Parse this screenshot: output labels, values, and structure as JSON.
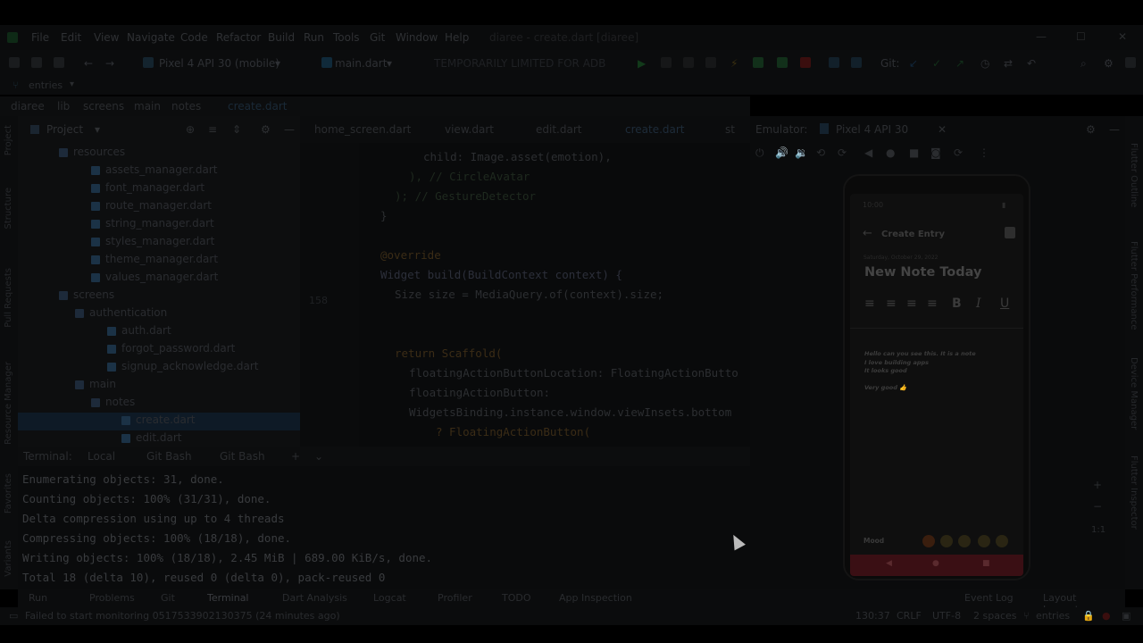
{
  "menu": {
    "items": [
      "File",
      "Edit",
      "View",
      "Navigate",
      "Code",
      "Refactor",
      "Build",
      "Run",
      "Tools",
      "Git",
      "Window",
      "Help"
    ],
    "app_title": "diaree - create.dart [diaree]"
  },
  "toolbar": {
    "device": "Pixel 4 API 30 (mobile)",
    "run_config": "main.dart",
    "status": "TEMPORARILY LIMITED FOR ADB",
    "git_label": "Git:",
    "branch": "entries"
  },
  "breadcrumb": [
    "diaree",
    "lib",
    "screens",
    "main",
    "notes",
    "create.dart"
  ],
  "project": {
    "title": "Project",
    "tree": [
      {
        "label": "resources",
        "type": "folder"
      },
      {
        "label": "assets_manager.dart",
        "type": "file"
      },
      {
        "label": "font_manager.dart",
        "type": "file"
      },
      {
        "label": "route_manager.dart",
        "type": "file"
      },
      {
        "label": "string_manager.dart",
        "type": "file"
      },
      {
        "label": "styles_manager.dart",
        "type": "file"
      },
      {
        "label": "theme_manager.dart",
        "type": "file"
      },
      {
        "label": "values_manager.dart",
        "type": "file"
      },
      {
        "label": "screens",
        "type": "folder"
      },
      {
        "label": "authentication",
        "type": "folder"
      },
      {
        "label": "auth.dart",
        "type": "file"
      },
      {
        "label": "forgot_password.dart",
        "type": "file"
      },
      {
        "label": "signup_acknowledge.dart",
        "type": "file"
      },
      {
        "label": "main",
        "type": "folder"
      },
      {
        "label": "notes",
        "type": "folder"
      },
      {
        "label": "create.dart",
        "type": "file"
      },
      {
        "label": "edit.dart",
        "type": "file"
      }
    ]
  },
  "editor": {
    "tabs": [
      "home_screen.dart",
      "view.dart",
      "edit.dart",
      "create.dart",
      "st"
    ],
    "line_number": "158",
    "code": [
      "child: Image.asset(emotion),",
      "), // CircleAvatar",
      "); // GestureDetector",
      "}",
      "",
      "@override",
      "Widget build(BuildContext context) {",
      "Size size = MediaQuery.of(context).size;",
      "",
      "",
      "return Scaffold(",
      "floatingActionButtonLocation: FloatingActionButto",
      "floatingActionButton:",
      "WidgetsBinding.instance.window.viewInsets.bottom",
      "? FloatingActionButton("
    ]
  },
  "terminal": {
    "tabs": [
      "Terminal:",
      "Local",
      "Git Bash",
      "Git Bash"
    ],
    "lines": [
      "Enumerating objects: 31, done.",
      "Counting objects: 100% (31/31), done.",
      "Delta compression using up to 4 threads",
      "Compressing objects: 100% (18/18), done.",
      "Writing objects: 100% (18/18), 2.45 MiB | 689.00 KiB/s, done.",
      "Total 18 (delta 10), reused 0 (delta 0), pack-reused 0"
    ]
  },
  "tool_windows": [
    "Run",
    "Problems",
    "Git",
    "Terminal",
    "Dart Analysis",
    "Logcat",
    "Profiler",
    "TODO",
    "App Inspection"
  ],
  "tool_windows_right": [
    "Event Log",
    "Layout Inspector"
  ],
  "status": {
    "message": "Failed to start monitoring 0517533902130375 (24 minutes ago)",
    "position": "130:37",
    "line_ending": "CRLF",
    "encoding": "UTF-8",
    "indent": "2 spaces",
    "branch": "entries"
  },
  "left_strip": [
    "Project",
    "Structure",
    "Pull Requests",
    "Resource Manager",
    "Favorites",
    "Variants"
  ],
  "right_strip": [
    "Flutter Outline",
    "Flutter Performance",
    "Device Manager",
    "Flutter Inspector"
  ],
  "emulator": {
    "label": "Emulator:",
    "device_tab": "Pixel 4 API 30",
    "zoom": "1:1"
  },
  "phone": {
    "time": "10:00",
    "title": "Create Entry",
    "date": "Saturday, October 29, 2022",
    "heading": "New Note Today",
    "body": [
      "Hello can you see this. It is a note",
      "I love building apps",
      "It looks good",
      "",
      "Very good 👍"
    ],
    "mood_label": "Mood",
    "moods": [
      "😄",
      "😐",
      "😕",
      "😟",
      "😠"
    ]
  },
  "colors": {
    "background": "#000000",
    "phone_nav": "#3a0f14",
    "selection": "#0e1a26"
  }
}
